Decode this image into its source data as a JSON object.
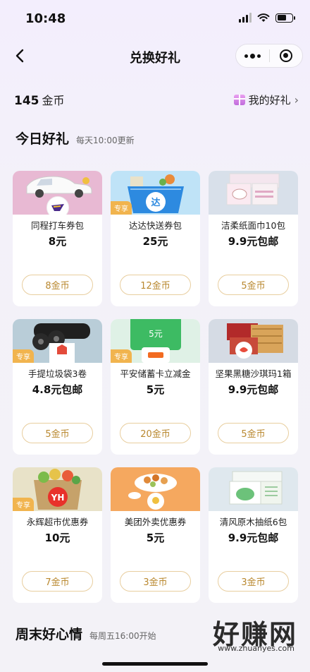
{
  "status_bar": {
    "time": "10:48"
  },
  "nav": {
    "title": "兑换好礼"
  },
  "coins": {
    "amount": "145",
    "unit": "金币",
    "my_gifts_label": "我的好礼"
  },
  "today_section": {
    "title": "今日好礼",
    "subtitle": "每天10:00更新"
  },
  "items": [
    {
      "name": "同程打车券包",
      "price": "8元",
      "cost": "8金币",
      "tag": "",
      "img_bg": "#e8b9d3"
    },
    {
      "name": "达达快送券包",
      "price": "25元",
      "cost": "12金币",
      "tag": "专享",
      "img_bg": "#bfe3f7"
    },
    {
      "name": "洁柔纸面巾10包",
      "price": "9.9元包邮",
      "cost": "5金币",
      "tag": "",
      "img_bg": "#d8e0ea"
    },
    {
      "name": "手提垃圾袋3卷",
      "price": "4.8元包邮",
      "cost": "5金币",
      "tag": "专享",
      "img_bg": "#b9cdd8"
    },
    {
      "name": "平安储蓄卡立减金",
      "price": "5元",
      "cost": "20金币",
      "tag": "专享",
      "img_bg": "#dff1e6",
      "card_text": "5元"
    },
    {
      "name": "坚果黑糖沙琪玛1箱",
      "price": "9.9元包邮",
      "cost": "5金币",
      "tag": "",
      "img_bg": "#d5dbe4"
    },
    {
      "name": "永辉超市优惠券",
      "price": "10元",
      "cost": "7金币",
      "tag": "专享",
      "img_bg": "#e8e2c8"
    },
    {
      "name": "美团外卖优惠券",
      "price": "5元",
      "cost": "3金币",
      "tag": "",
      "img_bg": "#f5a85f"
    },
    {
      "name": "清风原木抽纸6包",
      "price": "9.9元包邮",
      "cost": "3金币",
      "tag": "",
      "img_bg": "#dfe8ee"
    }
  ],
  "weekend_section": {
    "title": "周末好心情",
    "subtitle": "每周五16:00开始"
  },
  "watermark": {
    "text": "好赚网",
    "url": "www.zhuanyes.com"
  }
}
